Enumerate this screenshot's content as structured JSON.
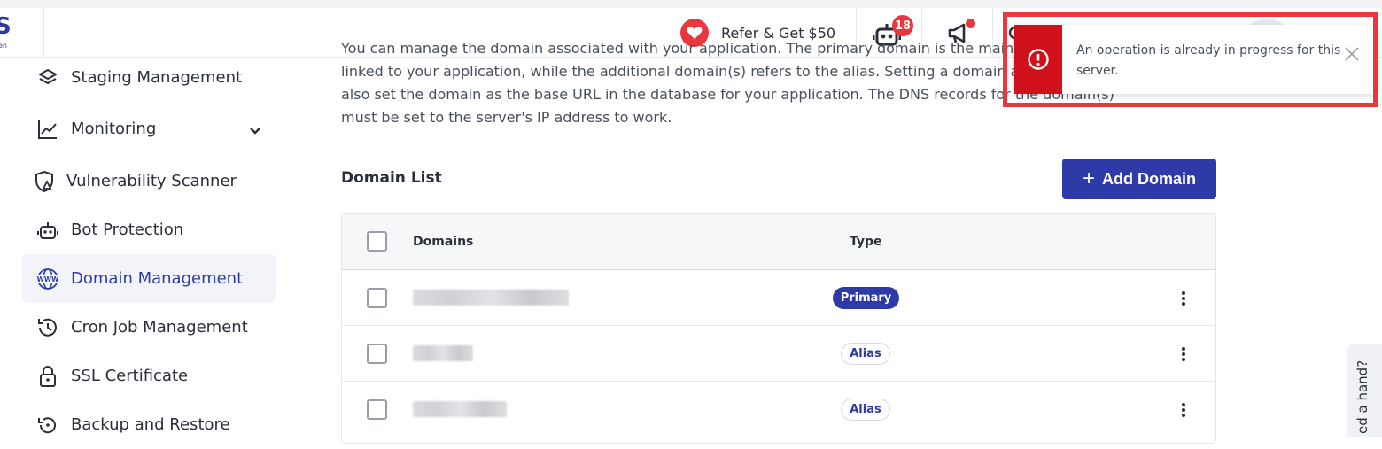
{
  "header": {
    "logo_letter": "S",
    "logo_sub": "en",
    "refer_label": "Refer & Get $50",
    "bot_badge": "18"
  },
  "sidebar": {
    "items": [
      {
        "label": "Staging Management"
      },
      {
        "label": "Monitoring"
      },
      {
        "label": "Vulnerability Scanner"
      },
      {
        "label": "Bot Protection"
      },
      {
        "label": "Domain Management"
      },
      {
        "label": "Cron Job Management"
      },
      {
        "label": "SSL Certificate"
      },
      {
        "label": "Backup and Restore"
      }
    ],
    "active": "Domain Management"
  },
  "main": {
    "description_lines": [
      "You can manage the domain associated with your application. The primary domain is the main",
      "linked to your application, while the additional domain(s) refers to the alias. Setting a domain a",
      "also set the domain as the base URL in the database for your application. The DNS records for the domain(s)",
      "must be set to the server's IP address to work."
    ],
    "section_title": "Domain List",
    "add_button": "Add Domain",
    "table": {
      "headers": {
        "domains": "Domains",
        "type": "Type"
      },
      "rows": [
        {
          "type": "Primary"
        },
        {
          "type": "Alias"
        },
        {
          "type": "Alias"
        }
      ]
    }
  },
  "toast": {
    "message": "An operation is already in progress for this server."
  },
  "help_tab": {
    "label": "ed a hand?"
  },
  "colors": {
    "brand": "#2e3aa8",
    "danger": "#d0111b",
    "highlight": "#e8383d"
  }
}
